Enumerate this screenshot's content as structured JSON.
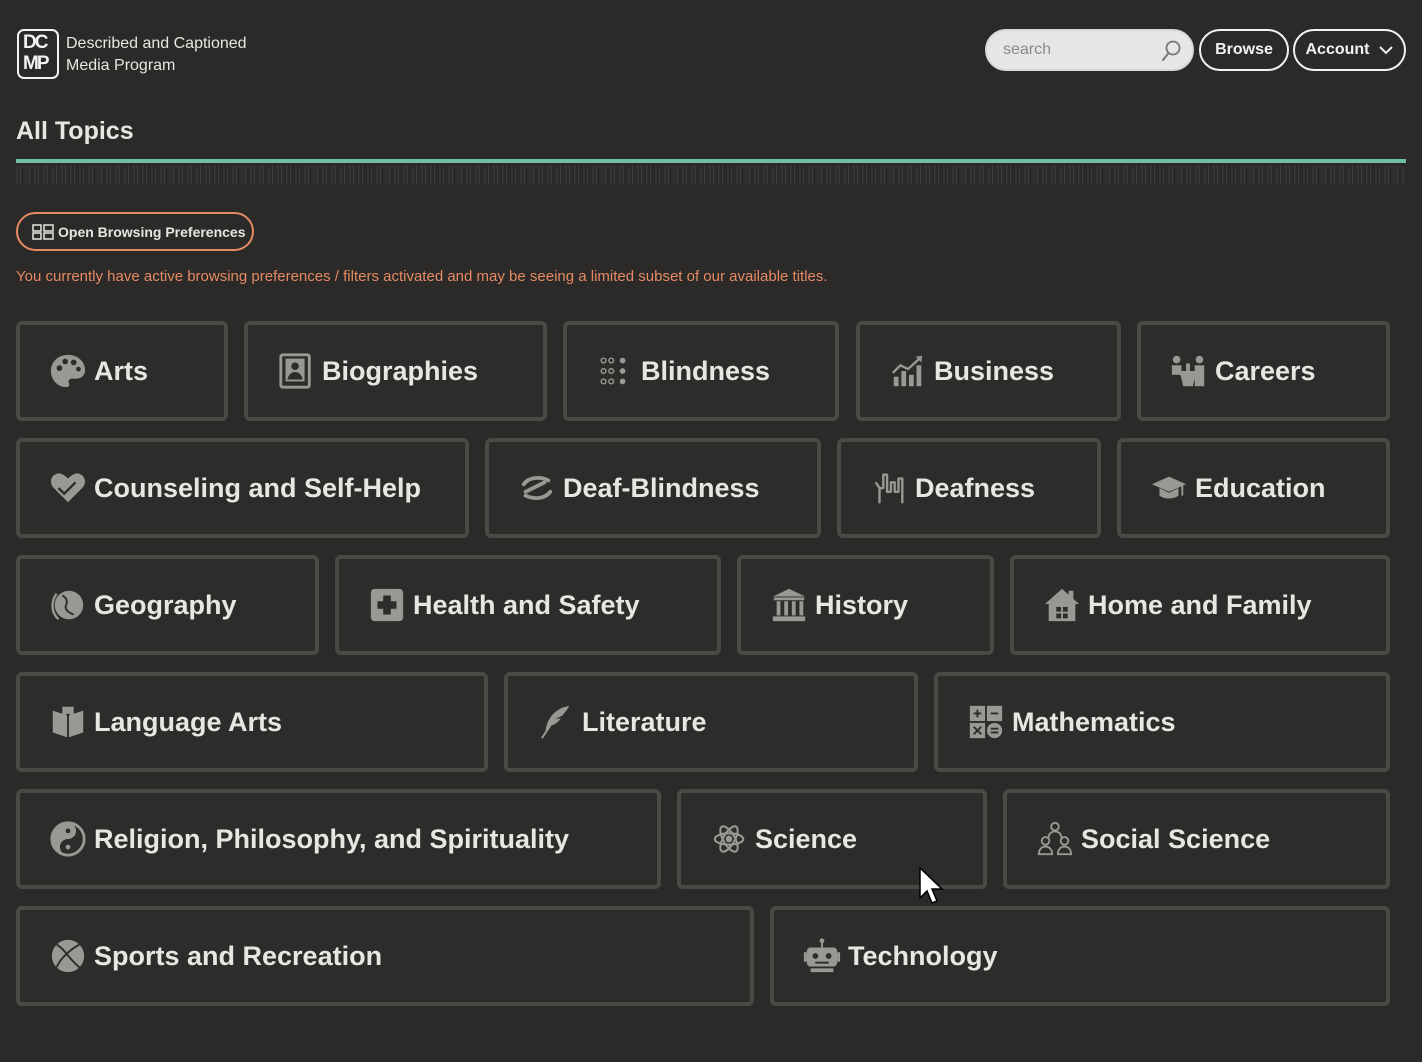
{
  "header": {
    "logo_top": "DC",
    "logo_bottom": "MP",
    "brand_line1": "Described and Captioned",
    "brand_line2": "Media Program",
    "search_placeholder": "search",
    "browse_label": "Browse",
    "account_label": "Account"
  },
  "page": {
    "title": "All Topics",
    "preferences_button": "Open Browsing Preferences",
    "preferences_note": "You currently have active browsing preferences / filters activated and may be seeing a limited subset of our available titles."
  },
  "topics": [
    {
      "label": "Arts",
      "icon": "palette-icon"
    },
    {
      "label": "Biographies",
      "icon": "portrait-icon"
    },
    {
      "label": "Blindness",
      "icon": "braille-icon"
    },
    {
      "label": "Business",
      "icon": "chart-growth-icon"
    },
    {
      "label": "Careers",
      "icon": "people-podium-icon"
    },
    {
      "label": "Counseling and Self-Help",
      "icon": "heart-hands-icon"
    },
    {
      "label": "Deaf-Blindness",
      "icon": "hands-swap-icon"
    },
    {
      "label": "Deafness",
      "icon": "sign-hand-icon"
    },
    {
      "label": "Education",
      "icon": "graduation-cap-icon"
    },
    {
      "label": "Geography",
      "icon": "globe-icon"
    },
    {
      "label": "Health and Safety",
      "icon": "first-aid-icon"
    },
    {
      "label": "History",
      "icon": "columns-building-icon"
    },
    {
      "label": "Home and Family",
      "icon": "house-icon"
    },
    {
      "label": "Language Arts",
      "icon": "open-book-icon"
    },
    {
      "label": "Literature",
      "icon": "quill-icon"
    },
    {
      "label": "Mathematics",
      "icon": "calculator-symbols-icon"
    },
    {
      "label": "Religion, Philosophy, and Spirituality",
      "icon": "yin-yang-icon"
    },
    {
      "label": "Science",
      "icon": "atom-icon"
    },
    {
      "label": "Social Science",
      "icon": "people-group-icon"
    },
    {
      "label": "Sports and Recreation",
      "icon": "ball-icon"
    },
    {
      "label": "Technology",
      "icon": "robot-icon"
    }
  ],
  "colors": {
    "background": "#2b2a28",
    "accent_rule": "#6fbfa2",
    "preference_accent": "#e58a63",
    "tile_border": "#4a4946",
    "icon_gray": "#9a9894"
  }
}
